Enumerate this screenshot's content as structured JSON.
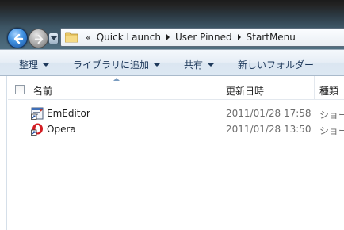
{
  "address": {
    "chevron": "«",
    "crumbs": [
      "Quick Launch",
      "User Pinned",
      "StartMenu"
    ]
  },
  "toolbar": {
    "organize": "整理",
    "add_to_library": "ライブラリに追加",
    "share": "共有",
    "new_folder": "新しいフォルダー"
  },
  "columns": {
    "name": "名前",
    "date_modified": "更新日時",
    "type": "種類"
  },
  "files": [
    {
      "name": "EmEditor",
      "date": "2011/01/28 17:58",
      "type": "ショー",
      "icon": "emeditor-shortcut-icon"
    },
    {
      "name": "Opera",
      "date": "2011/01/28 13:50",
      "type": "ショー",
      "icon": "opera-shortcut-icon"
    }
  ],
  "colors": {
    "toolbar_text": "#1e395b",
    "secondary_text": "#6d6d6d"
  }
}
